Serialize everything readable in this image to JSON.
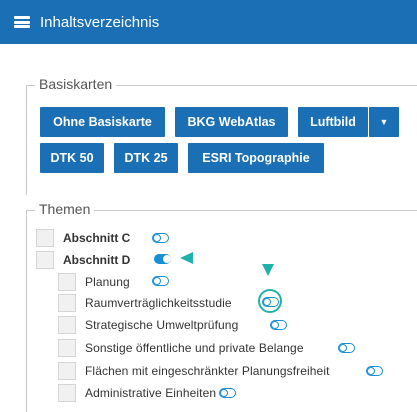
{
  "header": {
    "title": "Inhaltsverzeichnis",
    "icon": "list-icon"
  },
  "base_maps": {
    "legend": "Basiskarten",
    "buttons": [
      "Ohne Basiskarte",
      "BKG WebAtlas",
      "Luftbild",
      "DTK 50",
      "DTK 25",
      "ESRI Topographie"
    ],
    "dropdown_icon": "caret-down-icon"
  },
  "themes": {
    "legend": "Themen",
    "items": [
      {
        "label": "Abschnitt C",
        "checked": false,
        "toggle_on": false
      },
      {
        "label": "Abschnitt D",
        "checked": false,
        "toggle_on": true
      },
      {
        "label": "Planung",
        "checked": false,
        "toggle_on": false
      },
      {
        "label": "Raumverträglichkeitsstudie",
        "checked": false,
        "toggle_on": false
      },
      {
        "label": "Strategische Umweltprüfung",
        "checked": false,
        "toggle_on": false
      },
      {
        "label": "Sonstige öffentliche und private Belange",
        "checked": false,
        "toggle_on": false
      },
      {
        "label": "Flächen mit eingeschränkter Planungsfreiheit",
        "checked": false,
        "toggle_on": false
      },
      {
        "label": "Administrative Einheiten",
        "checked": false,
        "toggle_on": false
      }
    ]
  },
  "colors": {
    "header": "#1a6fb5",
    "toggle": "#1a8fd6",
    "highlight": "#20b2aa"
  }
}
